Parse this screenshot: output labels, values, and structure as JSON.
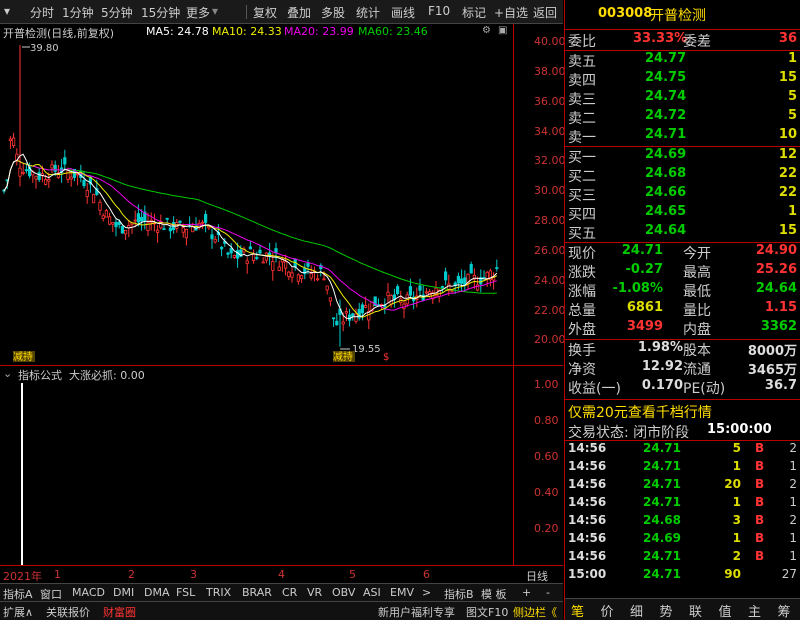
{
  "toolbar": {
    "left": [
      "分时",
      "1分钟",
      "5分钟",
      "15分钟",
      "更多"
    ],
    "right": [
      "复权",
      "叠加",
      "多股",
      "统计",
      "画线",
      "F10",
      "标记",
      "+自选",
      "返回"
    ]
  },
  "legend": {
    "name": "开普检测(日线,前复权)",
    "ma5": "MA5: 24.78",
    "ma10": "MA10: 24.33",
    "ma20": "MA20: 23.99",
    "ma60": "MA60: 23.46"
  },
  "main_chart": {
    "yticks": [
      "40.00",
      "38.00",
      "36.00",
      "34.00",
      "32.00",
      "30.00",
      "28.00",
      "26.00",
      "24.00",
      "22.00",
      "20.00"
    ],
    "high_label": "39.80",
    "low_label": "19.55",
    "tag1": "减持",
    "tag2": "减持",
    "tag3": "$"
  },
  "indicator": {
    "header": "指标公式  大涨必抓: 0.00",
    "yticks": [
      "1.00",
      "0.80",
      "0.60",
      "0.40",
      "0.20"
    ]
  },
  "xaxis": {
    "labels": [
      "2021年",
      "1",
      "2",
      "3",
      "4",
      "5",
      "6"
    ],
    "period": "日线"
  },
  "bottom_tabs": [
    "指标A",
    "窗口",
    "MACD",
    "DMI",
    "DMA",
    "FSL",
    "TRIX",
    "BRAR",
    "CR",
    "VR",
    "OBV",
    "ASI",
    "EMV",
    ">",
    "指标B",
    "模 板",
    "+",
    "-"
  ],
  "status": {
    "items": [
      "扩展∧",
      "关联报价",
      "财富圈"
    ],
    "right": [
      "新用户福利专享",
      "图文F10",
      "侧边栏《"
    ]
  },
  "quote": {
    "code": "003008",
    "name": "开普检测",
    "weibi_label": "委比",
    "weibi": "33.33%",
    "weicha_label": "委差",
    "weicha": "36",
    "asks": [
      {
        "label": "卖五",
        "price": "24.77",
        "vol": "1"
      },
      {
        "label": "卖四",
        "price": "24.75",
        "vol": "15"
      },
      {
        "label": "卖三",
        "price": "24.74",
        "vol": "5"
      },
      {
        "label": "卖二",
        "price": "24.72",
        "vol": "5"
      },
      {
        "label": "卖一",
        "price": "24.71",
        "vol": "10"
      }
    ],
    "bids": [
      {
        "label": "买一",
        "price": "24.69",
        "vol": "12"
      },
      {
        "label": "买二",
        "price": "24.68",
        "vol": "22"
      },
      {
        "label": "买三",
        "price": "24.66",
        "vol": "22"
      },
      {
        "label": "买四",
        "price": "24.65",
        "vol": "1"
      },
      {
        "label": "买五",
        "price": "24.64",
        "vol": "15"
      }
    ],
    "stats": [
      {
        "l1": "现价",
        "v1": "24.71",
        "c1": "g",
        "l2": "今开",
        "v2": "24.90",
        "c2": "r"
      },
      {
        "l1": "涨跌",
        "v1": "-0.27",
        "c1": "g",
        "l2": "最高",
        "v2": "25.26",
        "c2": "r"
      },
      {
        "l1": "涨幅",
        "v1": "-1.08%",
        "c1": "g",
        "l2": "最低",
        "v2": "24.64",
        "c2": "g"
      },
      {
        "l1": "总量",
        "v1": "6861",
        "c1": "y",
        "l2": "量比",
        "v2": "1.15",
        "c2": "r"
      },
      {
        "l1": "外盘",
        "v1": "3499",
        "c1": "r",
        "l2": "内盘",
        "v2": "3362",
        "c2": "g"
      }
    ],
    "stats2": [
      {
        "l1": "换手",
        "v1": "1.98%",
        "l2": "股本",
        "v2": "8000万"
      },
      {
        "l1": "净资",
        "v1": "12.92",
        "l2": "流通",
        "v2": "3465万"
      },
      {
        "l1": "收益(一)",
        "v1": "0.170",
        "l2": "PE(动)",
        "v2": "36.7"
      }
    ],
    "promo": "仅需20元查看千档行情",
    "trade_state_label": "交易状态: 闭市阶段",
    "trade_state_time": "15:00:00",
    "ticks": [
      {
        "t": "14:56",
        "p": "24.71",
        "v": "5",
        "s": "B",
        "n": "2"
      },
      {
        "t": "14:56",
        "p": "24.71",
        "v": "1",
        "s": "B",
        "n": "1"
      },
      {
        "t": "14:56",
        "p": "24.71",
        "v": "20",
        "s": "B",
        "n": "2"
      },
      {
        "t": "14:56",
        "p": "24.71",
        "v": "1",
        "s": "B",
        "n": "1"
      },
      {
        "t": "14:56",
        "p": "24.68",
        "v": "3",
        "s": "B",
        "n": "2"
      },
      {
        "t": "14:56",
        "p": "24.69",
        "v": "1",
        "s": "B",
        "n": "1"
      },
      {
        "t": "14:56",
        "p": "24.71",
        "v": "2",
        "s": "B",
        "n": "1"
      },
      {
        "t": "15:00",
        "p": "24.71",
        "v": "90",
        "s": "",
        "n": "27"
      }
    ],
    "bottom_tabs": [
      "笔",
      "价",
      "细",
      "势",
      "联",
      "值",
      "主",
      "筹"
    ]
  }
}
